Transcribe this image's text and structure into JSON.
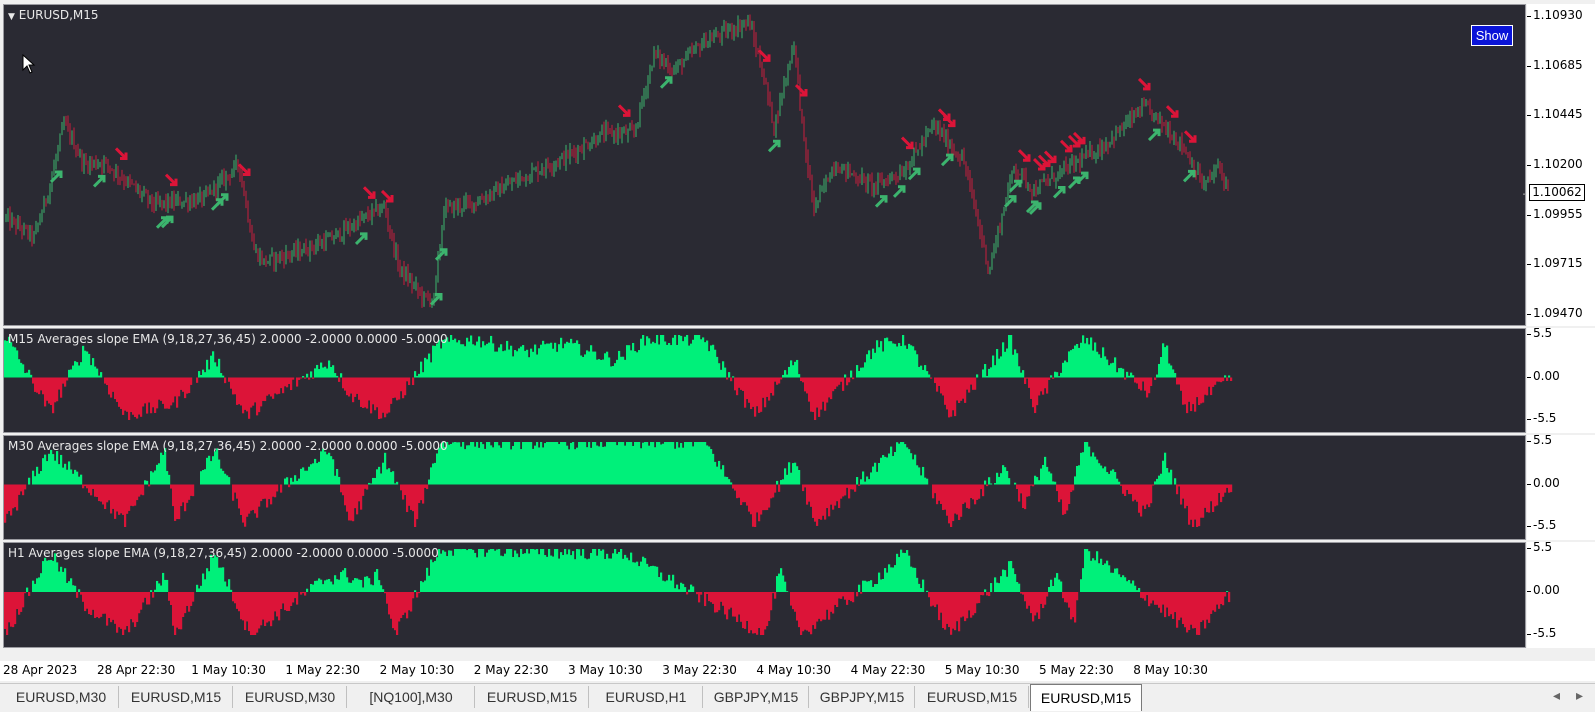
{
  "colors": {
    "background": "#2a2a33",
    "bull": "#00f07a",
    "bear": "#dc1438",
    "candle_up": "#3cb46e",
    "candle_down": "#c81e3c",
    "arrow_up": "#3cb46e",
    "arrow_down": "#dc1438",
    "accent_button": "#0a14d8"
  },
  "main": {
    "title": "EURUSD,M15",
    "show_button": "Show",
    "current_price": "1.10062",
    "price_ticks": [
      "1.10930",
      "1.10685",
      "1.10445",
      "1.10200",
      "1.09955",
      "1.09715",
      "1.09470"
    ]
  },
  "indicators": [
    {
      "label": "M15 Averages slope EMA (9,18,27,36,45) 2.0000 -2.0000 0.0000 -5.0000",
      "ticks": [
        "5.5",
        "0.00",
        "-5.5"
      ]
    },
    {
      "label": "M30 Averages slope EMA (9,18,27,36,45) 2.0000 -2.0000 0.0000 -5.0000",
      "ticks": [
        "5.5",
        "0.00",
        "-5.5"
      ]
    },
    {
      "label": "H1 Averages slope EMA (9,18,27,36,45) 2.0000 -2.0000 0.0000 -5.0000",
      "ticks": [
        "5.5",
        "0.00",
        "-5.5"
      ]
    }
  ],
  "time_labels": [
    "28 Apr 2023",
    "28 Apr 22:30",
    "1 May 10:30",
    "1 May 22:30",
    "2 May 10:30",
    "2 May 22:30",
    "3 May 10:30",
    "3 May 22:30",
    "4 May 10:30",
    "4 May 22:30",
    "5 May 10:30",
    "5 May 22:30",
    "8 May 10:30"
  ],
  "tabs": [
    {
      "label": "EURUSD,M30",
      "active": false
    },
    {
      "label": "EURUSD,M15",
      "active": false
    },
    {
      "label": "EURUSD,M30",
      "active": false
    },
    {
      "label": "[NQ100],M30",
      "active": false
    },
    {
      "label": "EURUSD,M15",
      "active": false
    },
    {
      "label": "EURUSD,H1",
      "active": false
    },
    {
      "label": "GBPJPY,M15",
      "active": false
    },
    {
      "label": "GBPJPY,M15",
      "active": false
    },
    {
      "label": "EURUSD,M15",
      "active": false
    },
    {
      "label": "EURUSD,M15",
      "active": true
    }
  ],
  "chart_data": {
    "type": "line",
    "ylim": [
      1.0941,
      1.1099
    ],
    "close_anchors": [
      [
        0,
        1.0995
      ],
      [
        30,
        1.0985
      ],
      [
        45,
        1.1009
      ],
      [
        60,
        1.1041
      ],
      [
        80,
        1.1021
      ],
      [
        100,
        1.1022
      ],
      [
        150,
        1.1001
      ],
      [
        200,
        1.1004
      ],
      [
        235,
        1.1021
      ],
      [
        250,
        1.0979
      ],
      [
        260,
        1.0973
      ],
      [
        300,
        1.0979
      ],
      [
        330,
        1.0985
      ],
      [
        355,
        1.0993
      ],
      [
        380,
        1.1
      ],
      [
        395,
        1.097
      ],
      [
        420,
        1.0955
      ],
      [
        430,
        1.0955
      ],
      [
        440,
        1.0999
      ],
      [
        470,
        1.1002
      ],
      [
        520,
        1.1015
      ],
      [
        560,
        1.1024
      ],
      [
        600,
        1.1036
      ],
      [
        630,
        1.1036
      ],
      [
        650,
        1.1075
      ],
      [
        670,
        1.1067
      ],
      [
        700,
        1.1081
      ],
      [
        745,
        1.1091
      ],
      [
        760,
        1.1063
      ],
      [
        770,
        1.1039
      ],
      [
        790,
        1.1081
      ],
      [
        800,
        1.1031
      ],
      [
        810,
        1.0999
      ],
      [
        830,
        1.1021
      ],
      [
        870,
        1.101
      ],
      [
        900,
        1.1018
      ],
      [
        930,
        1.104
      ],
      [
        960,
        1.1022
      ],
      [
        985,
        1.0969
      ],
      [
        1010,
        1.102
      ],
      [
        1030,
        1.1008
      ],
      [
        1060,
        1.1018
      ],
      [
        1100,
        1.103
      ],
      [
        1140,
        1.1049
      ],
      [
        1160,
        1.104
      ],
      [
        1180,
        1.1029
      ],
      [
        1200,
        1.101
      ],
      [
        1215,
        1.102
      ],
      [
        1225,
        1.1007
      ]
    ],
    "arrows_up_x": [
      52,
      95,
      158,
      163,
      213,
      218,
      357,
      437,
      432,
      662,
      770,
      877,
      895,
      910,
      943,
      1006,
      1011,
      1028,
      1031,
      1055,
      1070,
      1078,
      1150,
      1185
    ],
    "arrows_down_x": [
      117,
      167,
      240,
      383,
      365,
      620,
      760,
      797,
      903,
      940,
      945,
      1020,
      1035,
      1040,
      1046,
      1062,
      1070,
      1075,
      1140,
      1168,
      1186
    ],
    "indicator_series": [
      {
        "name": "M15",
        "segments": [
          [
            0,
            1.0
          ],
          [
            45,
            -0.8
          ],
          [
            80,
            0.7
          ],
          [
            120,
            -0.9
          ],
          [
            170,
            -0.6
          ],
          [
            210,
            0.5
          ],
          [
            240,
            -0.9
          ],
          [
            325,
            0.4
          ],
          [
            345,
            -0.4
          ],
          [
            380,
            -0.9
          ],
          [
            435,
            0.8
          ],
          [
            470,
            0.9
          ],
          [
            520,
            0.6
          ],
          [
            560,
            0.8
          ],
          [
            610,
            0.4
          ],
          [
            640,
            0.9
          ],
          [
            700,
            0.9
          ],
          [
            750,
            -0.9
          ],
          [
            790,
            0.4
          ],
          [
            810,
            -0.9
          ],
          [
            870,
            0.7
          ],
          [
            900,
            0.9
          ],
          [
            935,
            -0.4
          ],
          [
            945,
            -0.9
          ],
          [
            1005,
            0.9
          ],
          [
            1030,
            -0.7
          ],
          [
            1060,
            0.4
          ],
          [
            1080,
            0.9
          ],
          [
            1145,
            -0.4
          ],
          [
            1160,
            0.8
          ],
          [
            1180,
            -0.8
          ],
          [
            1227,
            0
          ]
        ]
      },
      {
        "name": "M30",
        "segments": [
          [
            0,
            -0.9
          ],
          [
            45,
            0.8
          ],
          [
            90,
            -0.2
          ],
          [
            120,
            -0.9
          ],
          [
            160,
            0.8
          ],
          [
            170,
            -0.9
          ],
          [
            210,
            0.8
          ],
          [
            240,
            -0.9
          ],
          [
            290,
            0.2
          ],
          [
            325,
            0.8
          ],
          [
            345,
            -0.9
          ],
          [
            380,
            0.6
          ],
          [
            410,
            -0.9
          ],
          [
            435,
            1.0
          ],
          [
            700,
            1.0
          ],
          [
            750,
            -0.9
          ],
          [
            790,
            0.6
          ],
          [
            810,
            -0.9
          ],
          [
            870,
            0.4
          ],
          [
            900,
            1.0
          ],
          [
            945,
            -0.9
          ],
          [
            1000,
            0.4
          ],
          [
            1020,
            -0.5
          ],
          [
            1040,
            0.6
          ],
          [
            1060,
            -0.8
          ],
          [
            1080,
            1.0
          ],
          [
            1140,
            -0.7
          ],
          [
            1160,
            0.6
          ],
          [
            1188,
            -1.0
          ],
          [
            1227,
            0
          ]
        ]
      },
      {
        "name": "H1",
        "segments": [
          [
            0,
            -1.0
          ],
          [
            45,
            0.9
          ],
          [
            80,
            -0.3
          ],
          [
            120,
            -1.0
          ],
          [
            160,
            0.4
          ],
          [
            170,
            -1.0
          ],
          [
            210,
            0.9
          ],
          [
            245,
            -1.0
          ],
          [
            320,
            0.3
          ],
          [
            340,
            0.4
          ],
          [
            360,
            0.2
          ],
          [
            375,
            0.4
          ],
          [
            390,
            -1.0
          ],
          [
            435,
            1.0
          ],
          [
            620,
            0.9
          ],
          [
            760,
            -1.0
          ],
          [
            775,
            0.5
          ],
          [
            795,
            -1.0
          ],
          [
            870,
            0.3
          ],
          [
            900,
            0.9
          ],
          [
            945,
            -1.0
          ],
          [
            1005,
            0.6
          ],
          [
            1030,
            -0.7
          ],
          [
            1050,
            0.4
          ],
          [
            1070,
            -0.7
          ],
          [
            1080,
            1.0
          ],
          [
            1190,
            -1.0
          ],
          [
            1227,
            0
          ]
        ]
      }
    ]
  }
}
